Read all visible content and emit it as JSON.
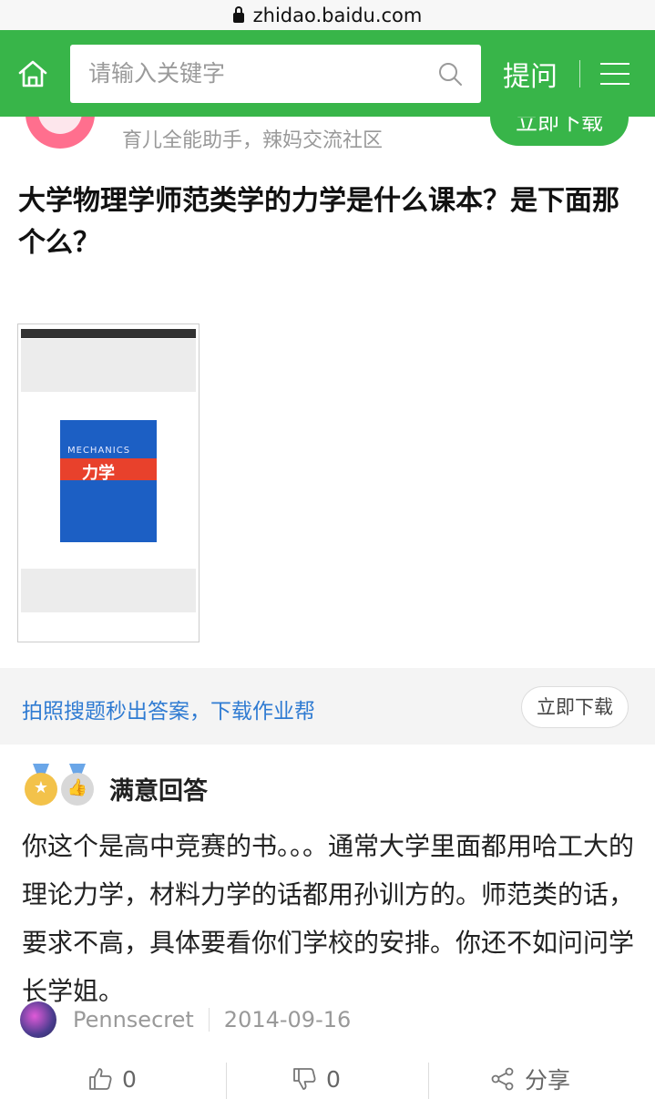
{
  "browser": {
    "url": "zhidao.baidu.com"
  },
  "header": {
    "search_placeholder": "请输入关键字",
    "ask_label": "提问"
  },
  "app_banner": {
    "tagline": "育儿全能助手，辣妈交流社区",
    "download_label": "立即下载"
  },
  "question": {
    "title": "大学物理学师范类学的力学是什么课本？是下面那个么？",
    "image": {
      "book_title_en": "MECHANICS",
      "book_title_zh": "力学"
    }
  },
  "promo": {
    "text": "拍照搜题秒出答案，下载作业帮",
    "button_label": "立即下载"
  },
  "answer": {
    "label": "满意回答",
    "body": "你这个是高中竞赛的书。。。通常大学里面都用哈工大的理论力学，材料力学的话都用孙训方的。师范类的话，要求不高，具体要看你们学校的安排。你还不如问问学长学姐。",
    "author": "Pennsecret",
    "date": "2014-09-16",
    "likes": "0",
    "dislikes": "0",
    "share_label": "分享"
  },
  "colors": {
    "brand_green": "#38b549",
    "link_blue": "#2f7bd2"
  }
}
